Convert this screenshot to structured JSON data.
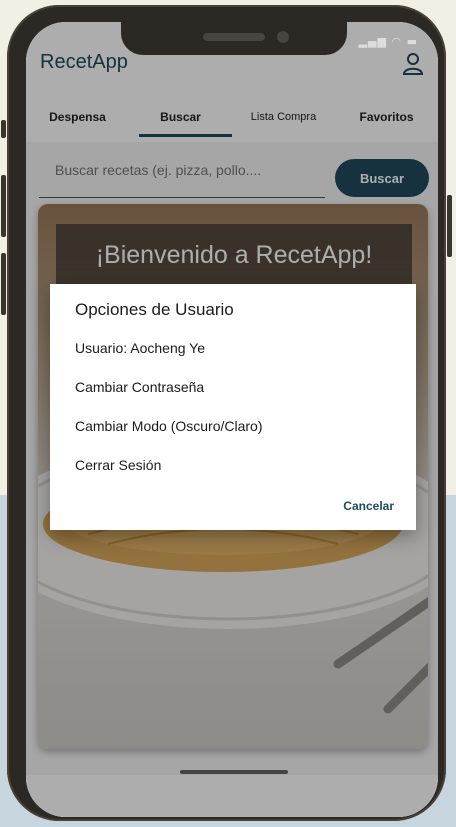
{
  "app": {
    "title": "RecetApp"
  },
  "tabs": [
    {
      "label": "Despensa"
    },
    {
      "label": "Buscar"
    },
    {
      "label": "Lista Compra"
    },
    {
      "label": "Favoritos"
    }
  ],
  "search": {
    "placeholder": "Buscar recetas (ej. pizza, pollo....",
    "button_label": "Buscar"
  },
  "banner": {
    "welcome": "¡Bienvenido a RecetApp!"
  },
  "dialog": {
    "title": "Opciones de Usuario",
    "items": [
      {
        "label": "Usuario: Aocheng Ye"
      },
      {
        "label": "Cambiar Contraseña"
      },
      {
        "label": "Cambiar Modo (Oscuro/Claro)"
      },
      {
        "label": "Cerrar Sesión"
      }
    ],
    "cancel_label": "Cancelar"
  },
  "colors": {
    "primary": "#1f4a5c"
  },
  "icons": {
    "user": "user-icon",
    "signal": "signal-icon",
    "wifi": "wifi-icon",
    "battery": "battery-icon"
  }
}
